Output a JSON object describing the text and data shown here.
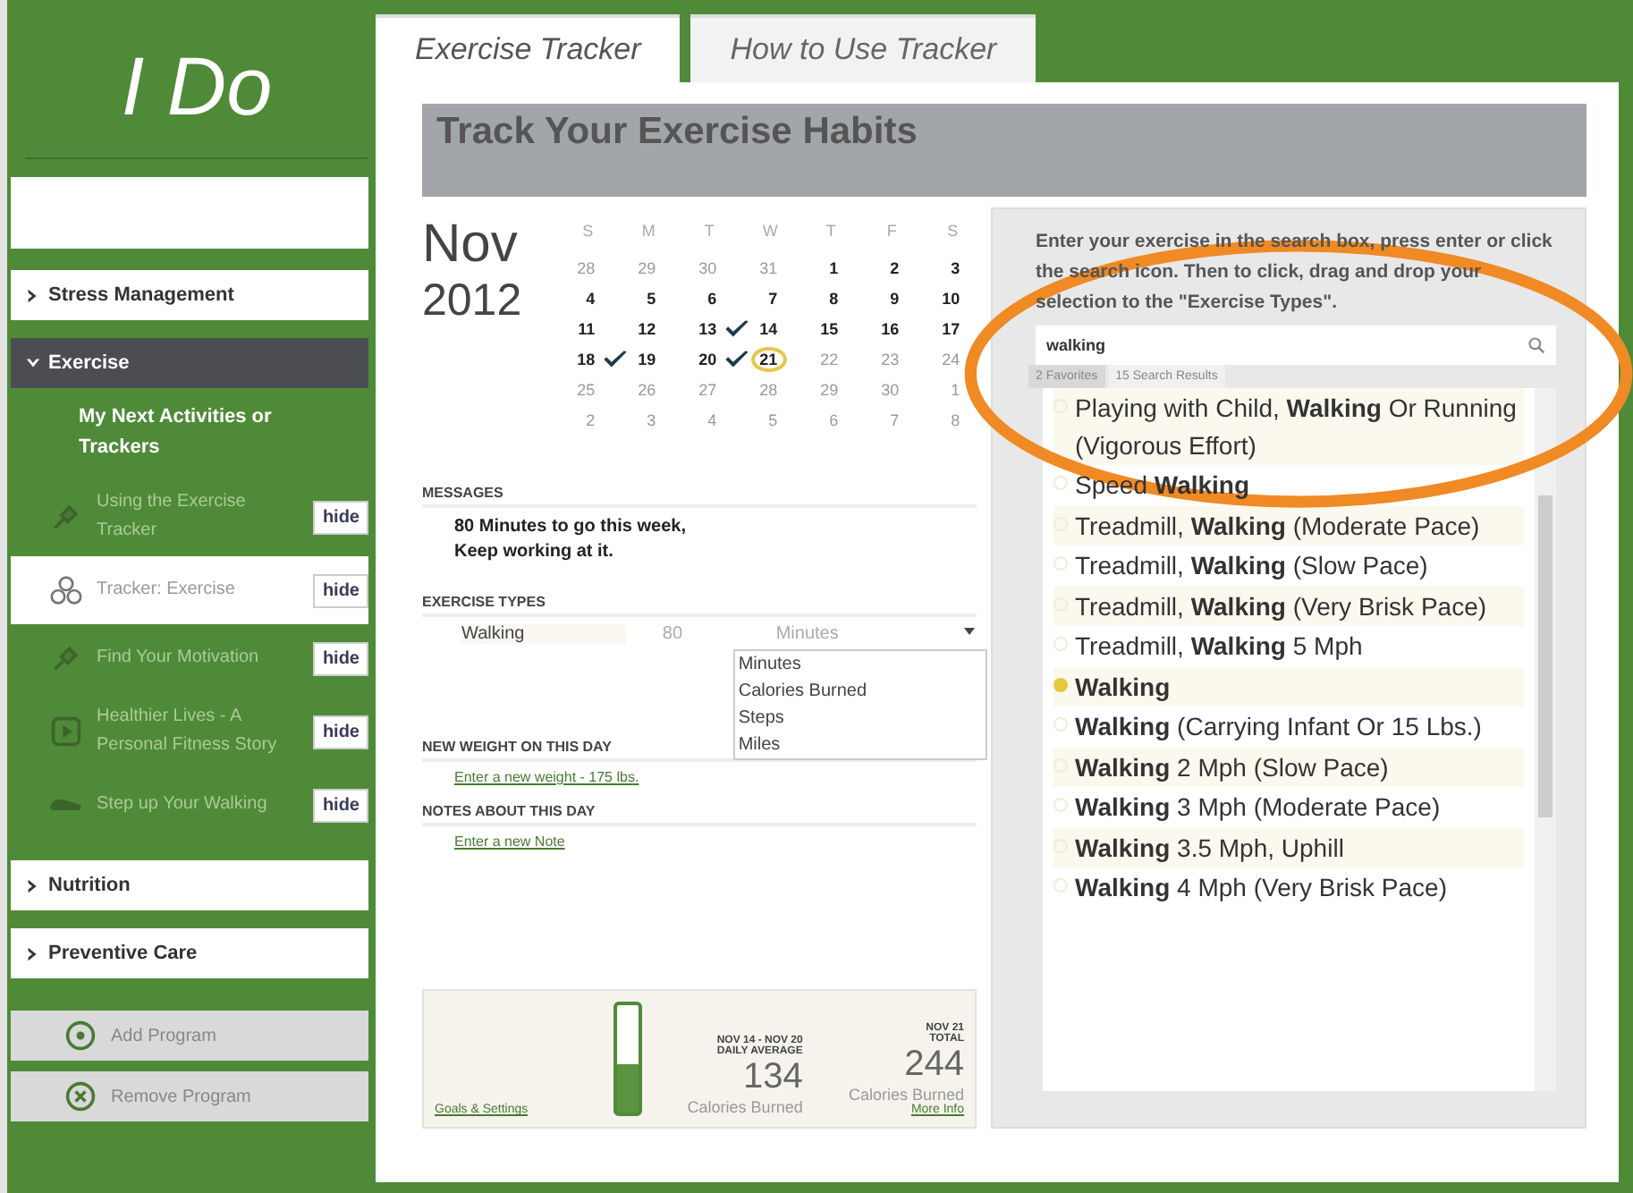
{
  "logo": "I Do",
  "sidebar": {
    "sections": [
      {
        "label": "Stress Management",
        "expanded": false
      },
      {
        "label": "Exercise",
        "expanded": true,
        "heading": "My Next Activities or Trackers",
        "items": [
          {
            "label": "Using the Exercise Tracker",
            "kind": "pin",
            "selected": false,
            "button": "hide"
          },
          {
            "label": "Tracker: Exercise",
            "kind": "tracker",
            "selected": true,
            "button": "hide"
          },
          {
            "label": "Find Your Motivation",
            "kind": "pin",
            "selected": false,
            "button": "hide"
          },
          {
            "label": "Healthier Lives - A Personal Fitness Story",
            "kind": "video",
            "selected": false,
            "button": "hide"
          },
          {
            "label": "Step up Your Walking",
            "kind": "shoe",
            "selected": false,
            "button": "hide"
          }
        ]
      },
      {
        "label": "Nutrition",
        "expanded": false
      },
      {
        "label": "Preventive Care",
        "expanded": false
      }
    ],
    "actions": [
      {
        "label": "Add Program",
        "kind": "add"
      },
      {
        "label": "Remove Program",
        "kind": "remove"
      }
    ]
  },
  "tabs": [
    {
      "label": "Exercise Tracker",
      "selected": true
    },
    {
      "label": "How to Use Tracker",
      "selected": false
    }
  ],
  "header": {
    "title": "Track Your Exercise Habits"
  },
  "calendar": {
    "month": "Nov",
    "year": "2012",
    "weekdays": [
      "S",
      "M",
      "T",
      "W",
      "T",
      "F",
      "S"
    ],
    "days": [
      {
        "day": "28",
        "faded": true,
        "checked": false,
        "today": false
      },
      {
        "day": "29",
        "faded": true,
        "checked": false,
        "today": false
      },
      {
        "day": "30",
        "faded": true,
        "checked": false,
        "today": false
      },
      {
        "day": "31",
        "faded": true,
        "checked": false,
        "today": false
      },
      {
        "day": "1",
        "faded": false,
        "checked": false,
        "today": false
      },
      {
        "day": "2",
        "faded": false,
        "checked": false,
        "today": false
      },
      {
        "day": "3",
        "faded": false,
        "checked": false,
        "today": false
      },
      {
        "day": "4",
        "faded": false,
        "checked": false,
        "today": false
      },
      {
        "day": "5",
        "faded": false,
        "checked": false,
        "today": false
      },
      {
        "day": "6",
        "faded": false,
        "checked": false,
        "today": false
      },
      {
        "day": "7",
        "faded": false,
        "checked": false,
        "today": false
      },
      {
        "day": "8",
        "faded": false,
        "checked": false,
        "today": false
      },
      {
        "day": "9",
        "faded": false,
        "checked": false,
        "today": false
      },
      {
        "day": "10",
        "faded": false,
        "checked": false,
        "today": false
      },
      {
        "day": "11",
        "faded": false,
        "checked": false,
        "today": false
      },
      {
        "day": "12",
        "faded": false,
        "checked": false,
        "today": false
      },
      {
        "day": "13",
        "faded": false,
        "checked": false,
        "today": false
      },
      {
        "day": "14",
        "faded": false,
        "checked": true,
        "today": false
      },
      {
        "day": "15",
        "faded": false,
        "checked": false,
        "today": false
      },
      {
        "day": "16",
        "faded": false,
        "checked": false,
        "today": false
      },
      {
        "day": "17",
        "faded": false,
        "checked": false,
        "today": false
      },
      {
        "day": "18",
        "faded": false,
        "checked": false,
        "today": false
      },
      {
        "day": "19",
        "faded": false,
        "checked": true,
        "today": false
      },
      {
        "day": "20",
        "faded": false,
        "checked": false,
        "today": false
      },
      {
        "day": "21",
        "faded": false,
        "checked": true,
        "today": true
      },
      {
        "day": "22",
        "faded": true,
        "checked": false,
        "today": false
      },
      {
        "day": "23",
        "faded": true,
        "checked": false,
        "today": false
      },
      {
        "day": "24",
        "faded": true,
        "checked": false,
        "today": false
      },
      {
        "day": "25",
        "faded": true,
        "checked": false,
        "today": false
      },
      {
        "day": "26",
        "faded": true,
        "checked": false,
        "today": false
      },
      {
        "day": "27",
        "faded": true,
        "checked": false,
        "today": false
      },
      {
        "day": "28",
        "faded": true,
        "checked": false,
        "today": false
      },
      {
        "day": "29",
        "faded": true,
        "checked": false,
        "today": false
      },
      {
        "day": "30",
        "faded": true,
        "checked": false,
        "today": false
      },
      {
        "day": "1",
        "faded": true,
        "checked": false,
        "today": false
      },
      {
        "day": "2",
        "faded": true,
        "checked": false,
        "today": false
      },
      {
        "day": "3",
        "faded": true,
        "checked": false,
        "today": false
      },
      {
        "day": "4",
        "faded": true,
        "checked": false,
        "today": false
      },
      {
        "day": "5",
        "faded": true,
        "checked": false,
        "today": false
      },
      {
        "day": "6",
        "faded": true,
        "checked": false,
        "today": false
      },
      {
        "day": "7",
        "faded": true,
        "checked": false,
        "today": false
      },
      {
        "day": "8",
        "faded": true,
        "checked": false,
        "today": false
      }
    ]
  },
  "messages": {
    "heading": "MESSAGES",
    "lines": [
      "80 Minutes to go this week,",
      "Keep working at it."
    ]
  },
  "exercise_types": {
    "heading": "EXERCISE TYPES",
    "name": "Walking",
    "amount": "80",
    "unit": "Minutes",
    "unit_options": [
      "Minutes",
      "Calories Burned",
      "Steps",
      "Miles"
    ]
  },
  "weight": {
    "heading": "NEW WEIGHT ON THIS DAY",
    "link": "Enter a new weight - 175 lbs."
  },
  "notes": {
    "heading": "NOTES ABOUT THIS DAY",
    "link": "Enter a new Note"
  },
  "summary": {
    "link": "Goals & Settings",
    "level": 0.45,
    "average_label": [
      "NOV 14 - NOV 20",
      "DAILY AVERAGE"
    ],
    "average": "134",
    "average_unit": "Calories Burned",
    "total_label": [
      "NOV 21",
      "TOTAL"
    ],
    "total": "244",
    "total_unit": "Calories Burned",
    "more": "More Info"
  },
  "search": {
    "instructions": "Enter your exercise in the search box, press enter or click the search icon. Then to click, drag and drop your selection to the \"Exercise Types\".",
    "value": "walking",
    "tabs": [
      {
        "label": "2 Favorites",
        "selected": false
      },
      {
        "label": "15 Search Results",
        "selected": true
      }
    ],
    "results": [
      {
        "text": "Playing with Child, **Walking** Or Running (Vigorous Effort)",
        "selected": false
      },
      {
        "text": "Speed **Walking**",
        "selected": false
      },
      {
        "text": "Treadmill, **Walking** (Moderate Pace)",
        "selected": false
      },
      {
        "text": "Treadmill, **Walking** (Slow Pace)",
        "selected": false
      },
      {
        "text": "Treadmill, **Walking** (Very Brisk Pace)",
        "selected": false
      },
      {
        "text": "Treadmill, **Walking** 5 Mph",
        "selected": false
      },
      {
        "text": "**Walking**",
        "selected": true
      },
      {
        "text": "**Walking** (Carrying Infant Or 15 Lbs.)",
        "selected": false
      },
      {
        "text": "**Walking** 2 Mph (Slow Pace)",
        "selected": false
      },
      {
        "text": "**Walking** 3 Mph (Moderate Pace)",
        "selected": false
      },
      {
        "text": "**Walking** 3.5 Mph, Uphill",
        "selected": false
      },
      {
        "text": "**Walking** 4 Mph (Very Brisk Pace)",
        "selected": false
      }
    ]
  }
}
